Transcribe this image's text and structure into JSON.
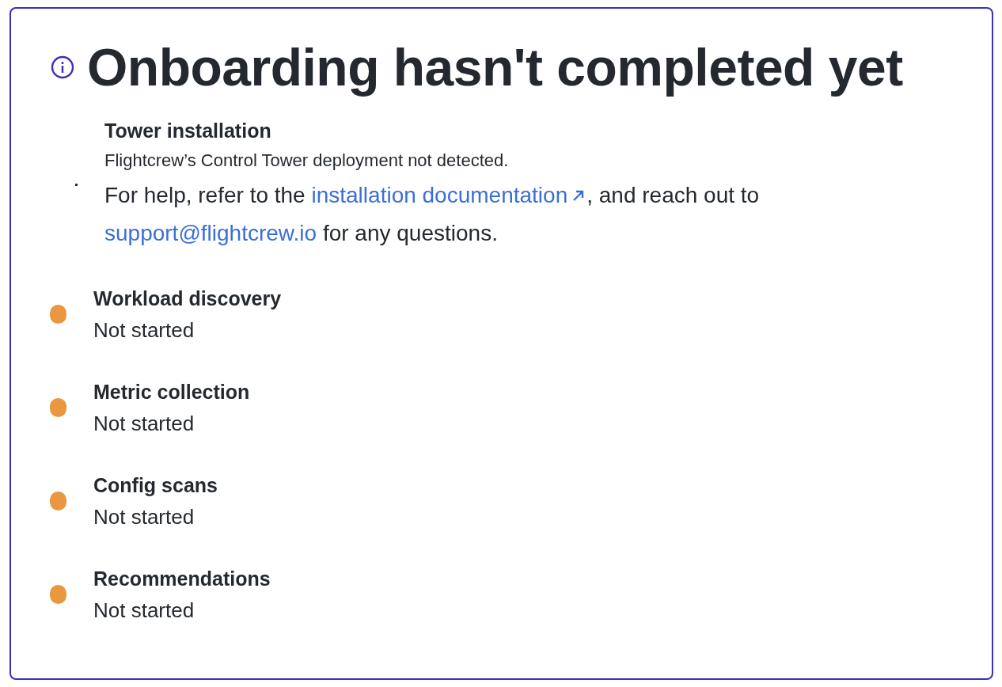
{
  "title": "Onboarding hasn't completed yet",
  "steps": [
    {
      "kind": "detail",
      "color": "#24292f",
      "name": "Tower installation",
      "description": "Flightcrew’s Control Tower deployment not detected.",
      "help": {
        "before": "For help, refer to the ",
        "link": "installation documentation",
        "middle": ", and reach out to ",
        "email": "support@flightcrew.io",
        "after": " for any questions."
      }
    },
    {
      "kind": "status",
      "color": "#e99841",
      "name": "Workload discovery",
      "status": "Not started"
    },
    {
      "kind": "status",
      "color": "#e99841",
      "name": "Metric collection",
      "status": "Not started"
    },
    {
      "kind": "status",
      "color": "#e99841",
      "name": "Config scans",
      "status": "Not started"
    },
    {
      "kind": "status",
      "color": "#e99841",
      "name": "Recommendations",
      "status": "Not started"
    }
  ]
}
